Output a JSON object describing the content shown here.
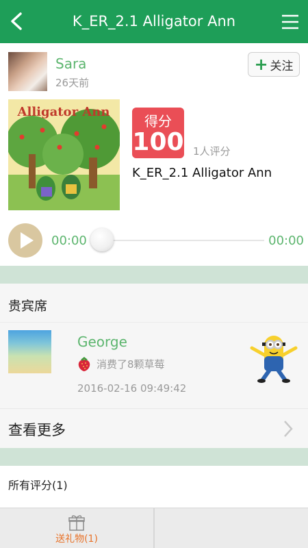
{
  "header": {
    "title": "K_ER_2.1 Alligator Ann",
    "back_icon": "chevron-left-icon",
    "menu_icon": "hamburger-menu-icon",
    "color": "#1e9e58"
  },
  "owner": {
    "name": "Sara",
    "time_ago": "26天前",
    "follow_label": "关注",
    "follow_icon": "plus-icon"
  },
  "work": {
    "cover_title": "Alligator Ann",
    "score_label": "得分",
    "score_value": "100",
    "raters": "1人评分",
    "title": "K_ER_2.1 Alligator Ann",
    "score_color": "#ea4e56"
  },
  "player": {
    "current_time": "00:00",
    "total_time": "00:00",
    "progress": 0,
    "play_icon": "play-icon"
  },
  "vip": {
    "title": "贵宾席",
    "guest": {
      "name": "George",
      "gift_text": "消费了8颗草莓",
      "gift_icon": "strawberry-icon",
      "timestamp": "2016-02-16 09:49:42"
    },
    "more_label": "查看更多",
    "more_icon": "chevron-right-icon"
  },
  "ratings": {
    "title": "所有评分(1)"
  },
  "bottom_bar": {
    "gift_label": "送礼物(1)",
    "gift_icon": "gift-icon"
  },
  "colors": {
    "accent_green": "#5cb56e",
    "band": "#cfe3d6",
    "orange": "#e8732a"
  }
}
